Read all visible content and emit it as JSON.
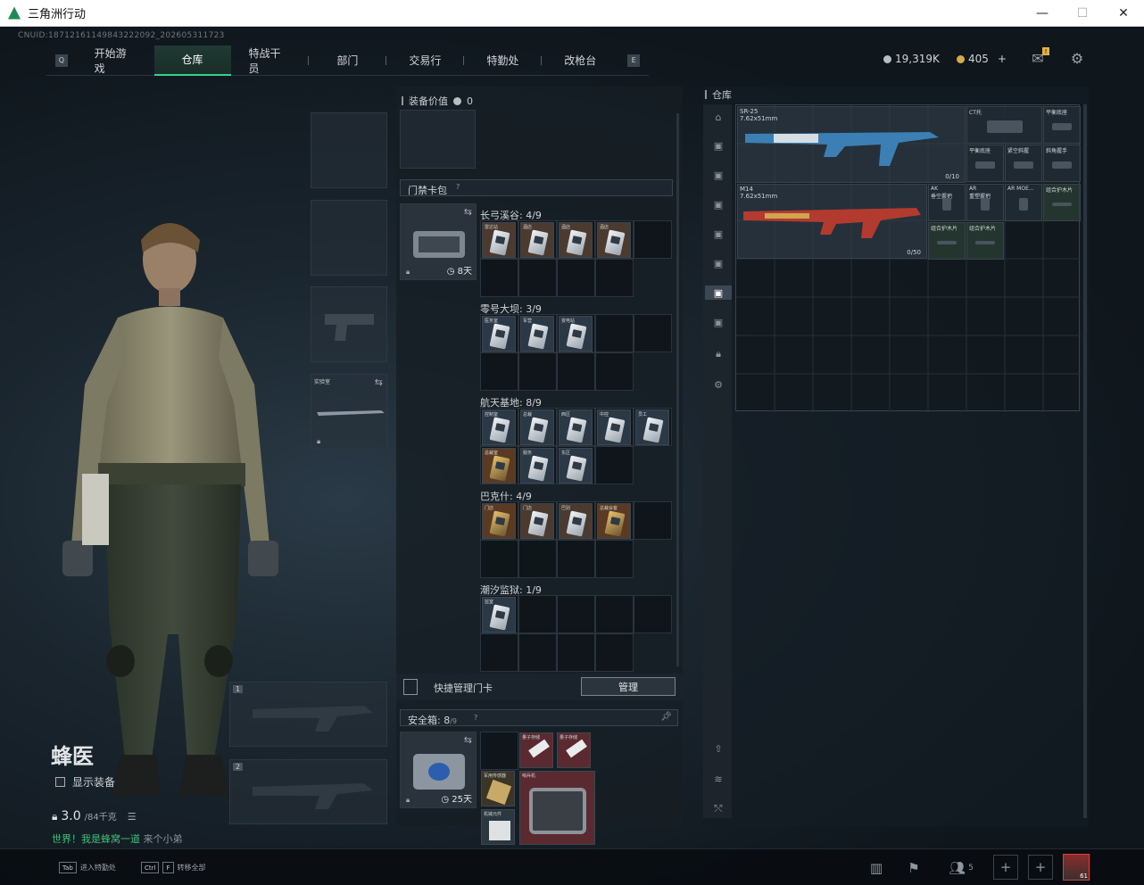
{
  "window": {
    "title": "三角洲行动",
    "minimize": "—",
    "maximize": "☐",
    "close": "✕"
  },
  "uid": "CNUID:18712161149843222092_202605311723",
  "nav": {
    "key_left": "Q",
    "key_right": "E",
    "tabs": [
      "开始游戏",
      "仓库",
      "特战干员",
      "部门",
      "交易行",
      "特勤处",
      "改枪台"
    ],
    "active": "仓库",
    "badge": "!"
  },
  "currency": {
    "silver": "19,319K",
    "coin": "405",
    "add": "+"
  },
  "character": {
    "name": "蜂医",
    "show_equipment": "显示装备",
    "weight": "3.0",
    "weight_max": "/84千克",
    "slogan_green": "世界！我是蜂窝一道",
    "slogan_gray": "来个小弟"
  },
  "slots": {
    "case_label": "实验室",
    "weapon1": "1",
    "weapon2": "2"
  },
  "middle": {
    "equip_value_label": "装备价值",
    "equip_value": "0",
    "keycard_pack": "门禁卡包",
    "keycard_pack_help": "?",
    "keycard_days": "8天",
    "maps": [
      {
        "title": "长弓溪谷: 4/9",
        "cards": [
          "雷达站",
          "酒店",
          "酒店",
          "酒店"
        ]
      },
      {
        "title": "零号大坝: 3/9",
        "cards": [
          "医务室",
          "军营",
          "变电站"
        ]
      },
      {
        "title": "航天基地: 8/9",
        "cards": [
          "控制室",
          "总裁",
          "西区",
          "中控",
          "员工",
          "总裁室",
          "服务",
          "东区"
        ]
      },
      {
        "title": "巴克什: 4/9",
        "cards": [
          "门店",
          "门店",
          "巴别",
          "总裁会客"
        ]
      },
      {
        "title": "潮汐监狱: 1/9",
        "cards": [
          "监室"
        ]
      }
    ],
    "quick_manage": "快捷管理门卡",
    "manage_button": "管理",
    "safebox_label": "安全箱:",
    "safebox_count": "8",
    "safebox_max": "/9",
    "safebox_help": "?",
    "safebox_days": "25天",
    "safebox_items": [
      "量子存储",
      "量子存储",
      "军用传感器",
      "哨兵机",
      "机械元件"
    ]
  },
  "right": {
    "title": "仓库",
    "items": [
      {
        "label": "SR-25",
        "sub": "7.62x51mm",
        "count": "0/10"
      },
      {
        "label": "M14",
        "sub": "7.62x51mm",
        "count": "0/50"
      },
      {
        "label": "CT托"
      },
      {
        "label": "平衡底座"
      },
      {
        "label": "平衡底座"
      },
      {
        "label": "紧空斜握"
      },
      {
        "label": "斜角握手"
      },
      {
        "label": "AK",
        "sub": "垂空握把"
      },
      {
        "label": "AR",
        "sub": "重塑握把"
      },
      {
        "label": "AR MOE..."
      },
      {
        "label": "组合护木片"
      },
      {
        "label": "组合护木片"
      },
      {
        "label": "组合护木片"
      }
    ]
  },
  "bottom": {
    "hint1_key": "Tab",
    "hint1": "进入特勤处",
    "hint2_key1": "Ctrl",
    "hint2_key2": "F",
    "hint2": "转移全部",
    "friends": "5",
    "level": "61"
  },
  "colors": {
    "accent": "#37d18f",
    "badge": "#e2b23a"
  }
}
